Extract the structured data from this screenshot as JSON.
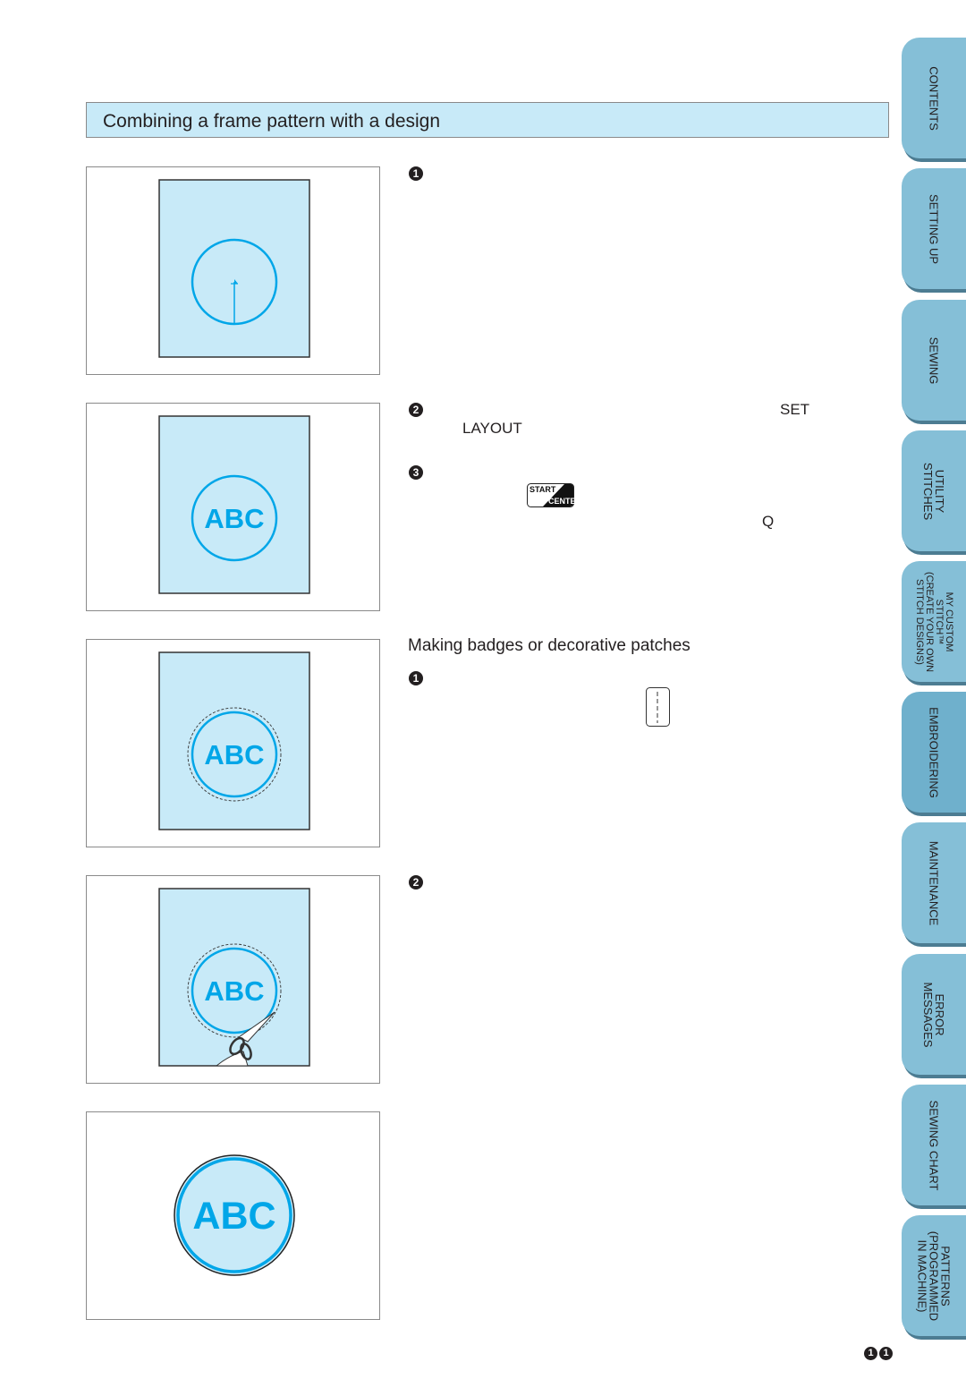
{
  "section_title": "Combining a frame pattern with a design",
  "subsection_title": "Making badges or decorative patches",
  "steps_frame": [
    {
      "number": "1",
      "text": ""
    },
    {
      "number": "2",
      "text_right": "SET",
      "text_line2": "LAYOUT"
    },
    {
      "number": "3",
      "button": "START CENTER",
      "text_right": "Q"
    }
  ],
  "steps_badge": [
    {
      "number": "1",
      "icon": "stitch-pattern-icon"
    },
    {
      "number": "2",
      "text": ""
    }
  ],
  "start_center_button": {
    "line1": "START",
    "line2": "CENTER"
  },
  "figures": [
    {
      "name": "figure-frame-circle",
      "label": ""
    },
    {
      "name": "figure-abc-in-frame",
      "label": "ABC"
    },
    {
      "name": "figure-abc-with-cut-line",
      "label": "ABC"
    },
    {
      "name": "figure-cutting-out-badge",
      "label": "ABC"
    },
    {
      "name": "figure-finished-badge",
      "label": "ABC"
    }
  ],
  "side_tabs": [
    {
      "label": "CONTENTS",
      "active": false
    },
    {
      "label": "SETTING UP",
      "active": false
    },
    {
      "label": "SEWING",
      "active": false
    },
    {
      "label": "UTILITY\nSTITCHES",
      "active": false
    },
    {
      "label": "MY CUSTOM\nSTITCH™\n(CREATE YOUR OWN\nSTITCH DESIGNS)",
      "active": false
    },
    {
      "label": "EMBROIDERING",
      "active": true
    },
    {
      "label": "MAINTENANCE",
      "active": false
    },
    {
      "label": "ERROR\nMESSAGES",
      "active": false
    },
    {
      "label": "SEWING CHART",
      "active": false
    },
    {
      "label": "PATTERNS\n(PROGRAMMED\nIN MACHINE)",
      "active": false
    }
  ],
  "page_number": [
    "1",
    "1"
  ],
  "colors": {
    "header_bg": "#c8eaf8",
    "fabric": "#c8eaf8",
    "stitch_blue": "#00a6e8",
    "tab_bg": "#85bfd7",
    "tab_shadow": "#4c7c92"
  }
}
